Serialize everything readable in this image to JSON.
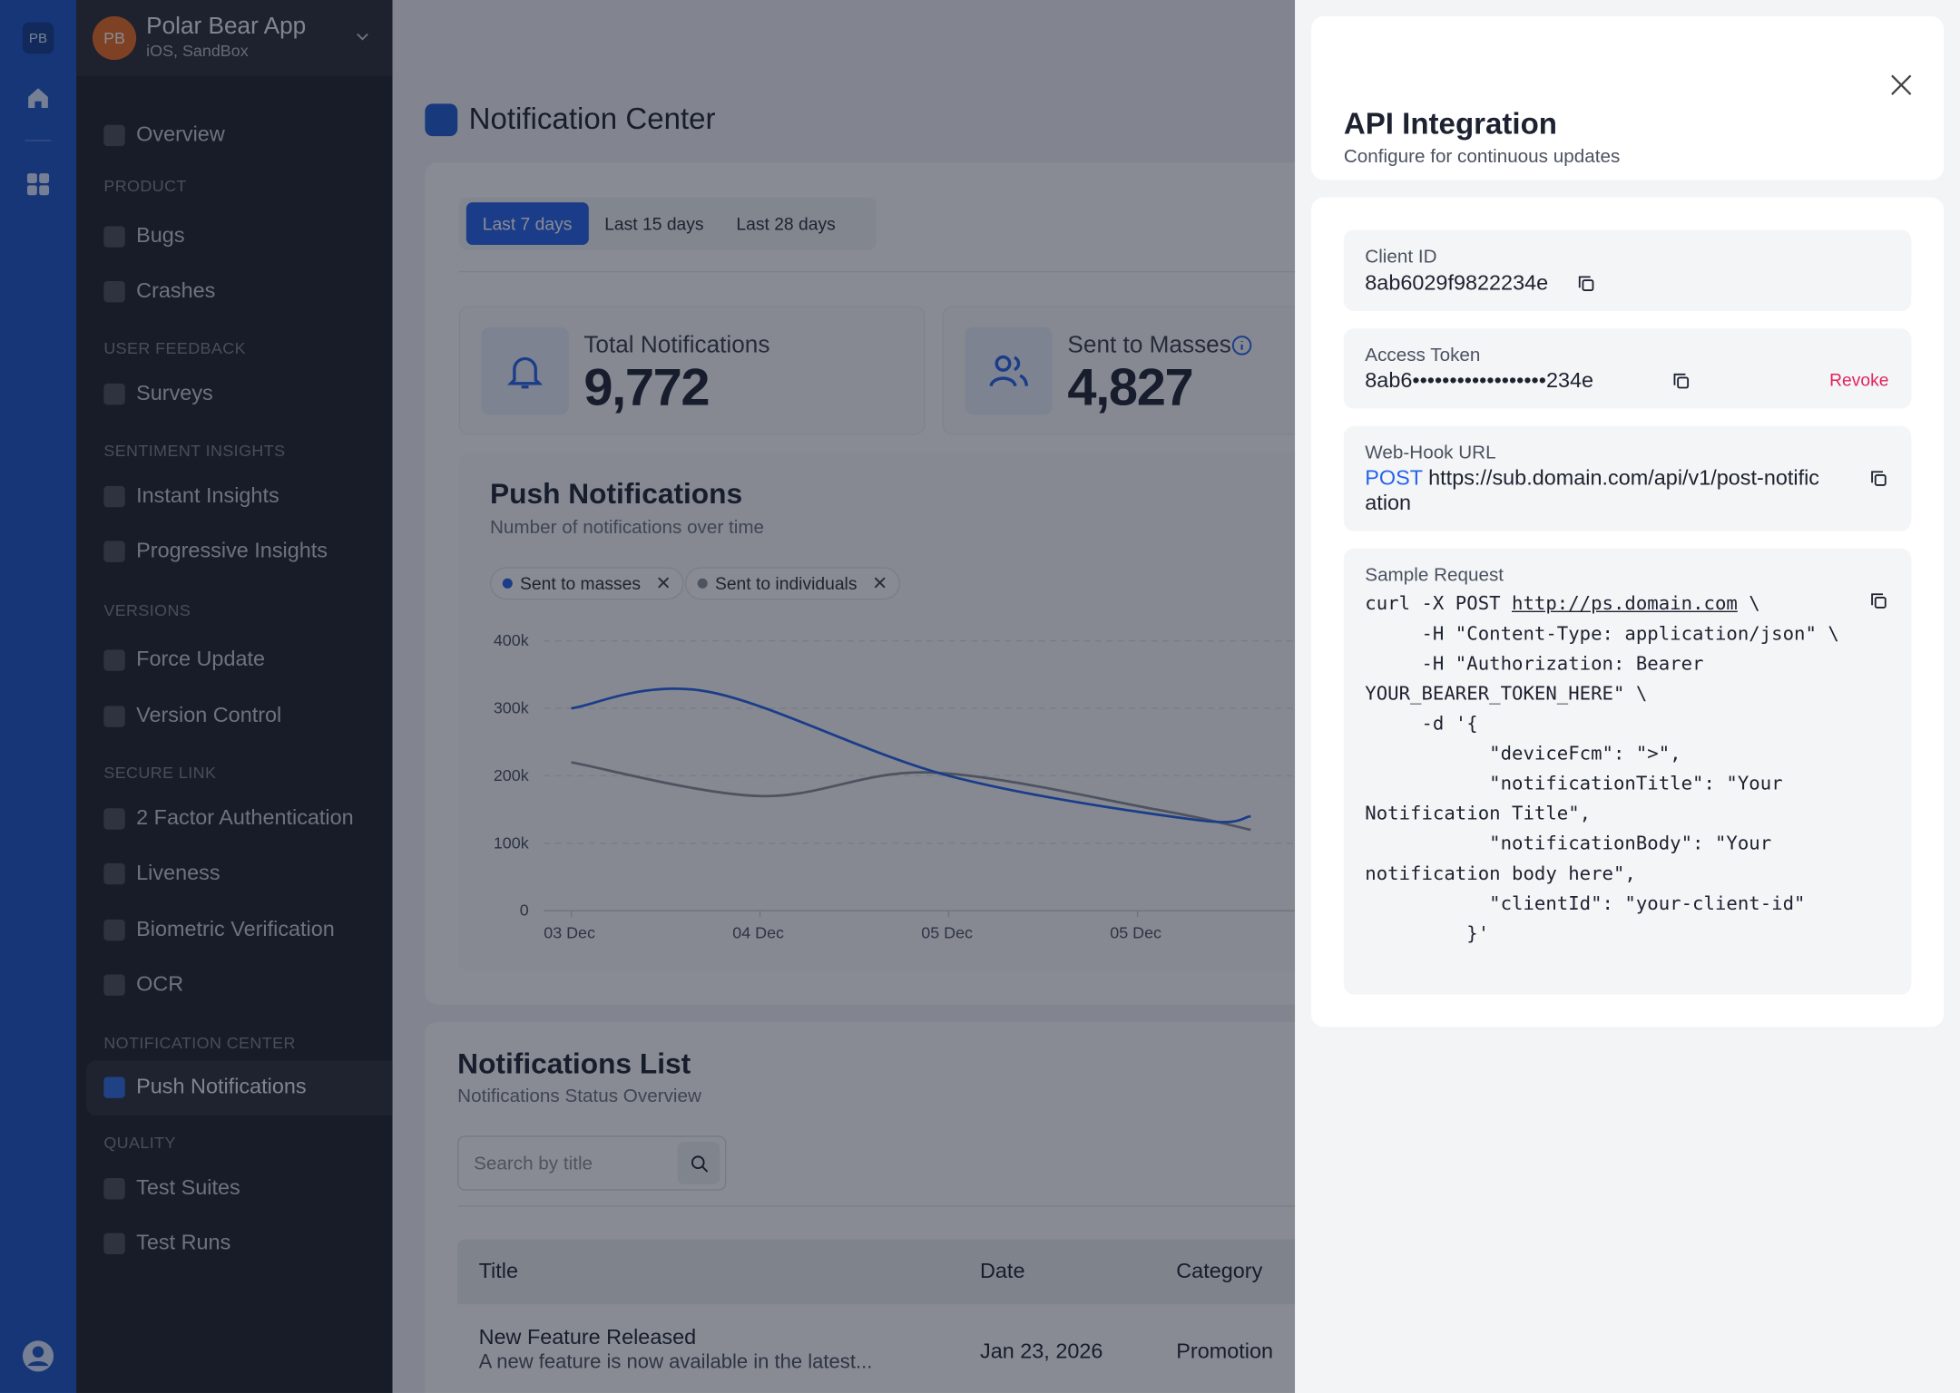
{
  "rail": {
    "badge": "PB",
    "icons": [
      "home-icon",
      "grid-icon",
      "user-circle-icon"
    ]
  },
  "sidebar": {
    "avatar": "PB",
    "app_name": "Polar Bear App",
    "app_sub": "iOS, SandBox",
    "overview": "Overview",
    "sections": {
      "product": "PRODUCT",
      "user_feedback": "USER FEEDBACK",
      "sentiment": "SENTIMENT INSIGHTS",
      "versions": "VERSIONS",
      "secure_link": "SECURE LINK",
      "notification_center": "NOTIFICATION CENTER",
      "quality": "QUALITY"
    },
    "items": {
      "bugs": "Bugs",
      "crashes": "Crashes",
      "surveys": "Surveys",
      "instant": "Instant Insights",
      "progressive": "Progressive Insights",
      "force_update": "Force Update",
      "version_control": "Version Control",
      "two_factor": "2 Factor Authentication",
      "liveness": "Liveness",
      "biometric": "Biometric Verification",
      "ocr": "OCR",
      "push": "Push Notifications",
      "test_suites": "Test Suites",
      "test_runs": "Test Runs"
    }
  },
  "main": {
    "title": "Notification Center",
    "filters": [
      "Last 7 days",
      "Last 15 days",
      "Last 28 days"
    ],
    "stats": {
      "total_label": "Total Notifications",
      "total_value": "9,772",
      "masses_label": "Sent to Masses",
      "masses_value": "4,827"
    },
    "chart": {
      "title": "Push Notifications",
      "subtitle": "Number of notifications over time",
      "chip_masses": "Sent to masses",
      "chip_individuals": "Sent to individuals"
    },
    "list": {
      "title": "Notifications List",
      "subtitle": "Notifications Status Overview",
      "search_placeholder": "Search by title",
      "columns": [
        "Title",
        "Date",
        "Category"
      ],
      "rows": [
        {
          "title": "New Feature Released",
          "desc": "A new feature is now available in the latest...",
          "date": "Jan 23, 2026",
          "category": "Promotion"
        }
      ]
    }
  },
  "chart_data": {
    "type": "line",
    "title": "Push Notifications",
    "subtitle": "Number of notifications over time",
    "x": [
      "03 Dec",
      "04 Dec",
      "05 Dec",
      "05 Dec"
    ],
    "ylim": [
      0,
      400000
    ],
    "yticks": [
      "0",
      "100k",
      "200k",
      "300k",
      "400k"
    ],
    "series": [
      {
        "name": "Sent to masses",
        "color": "#2563eb",
        "points": [
          [
            0,
            300000
          ],
          [
            0.72,
            325000
          ],
          [
            2,
            200000
          ],
          [
            3.3,
            135000
          ],
          [
            3.6,
            140000
          ]
        ]
      },
      {
        "name": "Sent to individuals",
        "color": "#8a8f99",
        "points": [
          [
            0,
            220000
          ],
          [
            1,
            170000
          ],
          [
            1.9,
            205000
          ],
          [
            3.1,
            150000
          ],
          [
            3.6,
            120000
          ]
        ]
      }
    ]
  },
  "drawer": {
    "title": "API Integration",
    "subtitle": "Configure for continuous updates",
    "client_id_label": "Client ID",
    "client_id": "8ab6029f9822234e",
    "token_label": "Access Token",
    "token": "8ab6••••••••••••••••••234e",
    "revoke": "Revoke",
    "webhook_label": "Web-Hook URL",
    "webhook_method": "POST",
    "webhook_url": "https://sub.domain.com/api/v1/post-notification",
    "sample_label": "Sample Request",
    "sample_line1_pre": "curl -X POST ",
    "sample_line1_url": "http://ps.domain.com",
    "sample_line1_post": " \\",
    "sample_rest": "     -H \"Content-Type: application/json\" \\\n     -H \"Authorization: Bearer YOUR_BEARER_TOKEN_HERE\" \\\n     -d '{\n           \"deviceFcm\": \">\",\n           \"notificationTitle\": \"Your Notification Title\",\n           \"notificationBody\": \"Your notification body here\",\n           \"clientId\": \"your-client-id\"\n         }'"
  },
  "colors": {
    "accent": "#2563eb",
    "rail": "#1a55c9",
    "sidebar": "#1f2128",
    "danger": "#e0245e"
  }
}
